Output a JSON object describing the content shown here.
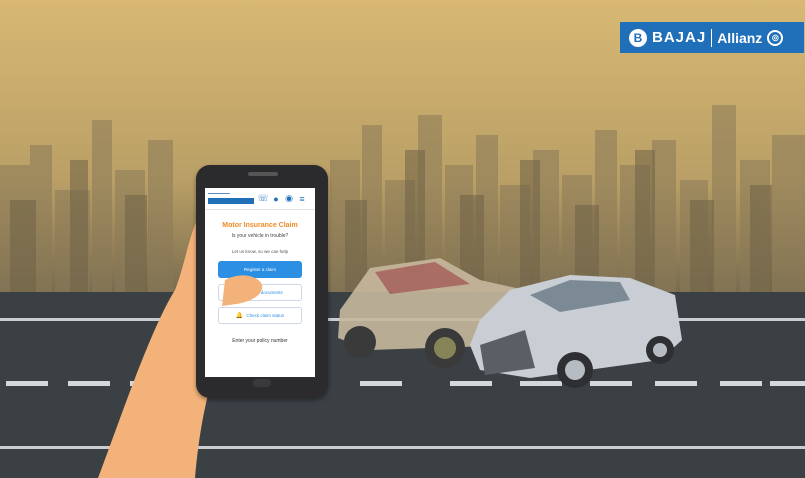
{
  "brand": {
    "name": "BAJAJ",
    "partner": "Allianz",
    "badge_glyph": "B",
    "eagle_glyph": "◎",
    "color": "#1f6fb9"
  },
  "phone_screen": {
    "title": "Motor Insurance Claim",
    "subtitle": "Is your vehicle in trouble?",
    "help_text": "Let us know, so we can help",
    "buttons": [
      {
        "label": "Register a claim",
        "icon": "",
        "style": "primary"
      },
      {
        "label": "Upload documents",
        "icon": "upload-icon",
        "glyph": "⇪",
        "style": "outline"
      },
      {
        "label": "Check claim status",
        "icon": "bell-icon",
        "glyph": "🔔",
        "style": "outline"
      }
    ],
    "policy_prompt": "Enter your policy number",
    "nav_icons": [
      "phone-icon",
      "user-icon",
      "profile-icon",
      "menu-icon"
    ],
    "accent_color": "#2b8fe3",
    "title_color": "#f08a24"
  }
}
